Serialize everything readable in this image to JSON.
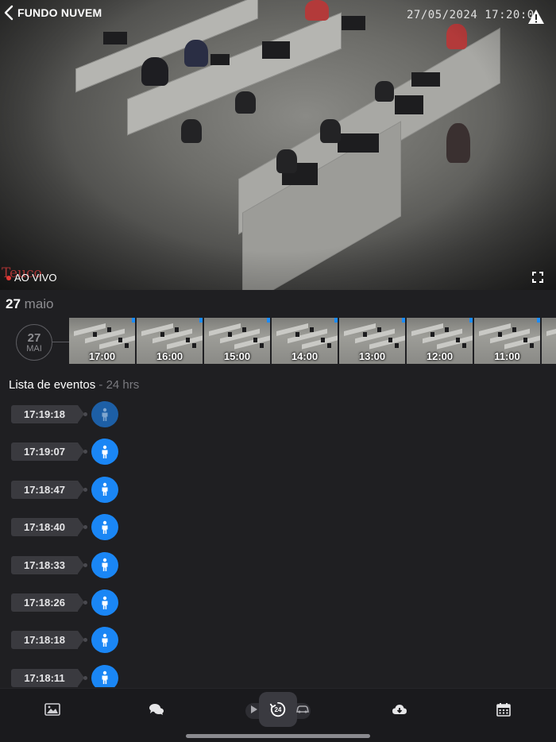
{
  "header": {
    "back_label": "FUNDO NUVEM",
    "timestamp": "27/05/2024 17:20:0",
    "camera_name": "Teuco",
    "live_label": "AO VIVO"
  },
  "date": {
    "day": "27",
    "month": "maio",
    "circle_day": "27",
    "circle_month": "MAI"
  },
  "thumbnails": [
    {
      "time": "17:00"
    },
    {
      "time": "16:00"
    },
    {
      "time": "15:00"
    },
    {
      "time": "14:00"
    },
    {
      "time": "13:00"
    },
    {
      "time": "12:00"
    },
    {
      "time": "11:00"
    },
    {
      "time": ""
    }
  ],
  "events": {
    "title": "Lista de eventos",
    "subtitle": " - 24 hrs",
    "items": [
      {
        "time": "17:19:18",
        "type": "person-icon",
        "active": true
      },
      {
        "time": "17:19:07",
        "type": "person-icon",
        "active": false
      },
      {
        "time": "17:18:47",
        "type": "person-icon",
        "active": false
      },
      {
        "time": "17:18:40",
        "type": "person-icon",
        "active": false
      },
      {
        "time": "17:18:33",
        "type": "person-icon",
        "active": false
      },
      {
        "time": "17:18:26",
        "type": "person-icon",
        "active": false
      },
      {
        "time": "17:18:18",
        "type": "person-icon",
        "active": false
      },
      {
        "time": "17:18:11",
        "type": "person-icon",
        "active": false
      }
    ]
  },
  "toolbar": {
    "items": [
      "gallery-icon",
      "chat-icon",
      "play-icon",
      "history-24-icon",
      "car-icon",
      "cloud-download-icon",
      "calendar-icon"
    ]
  },
  "colors": {
    "accent": "#1a86f5",
    "background": "#1f1f22",
    "live_dot": "#e53935"
  }
}
